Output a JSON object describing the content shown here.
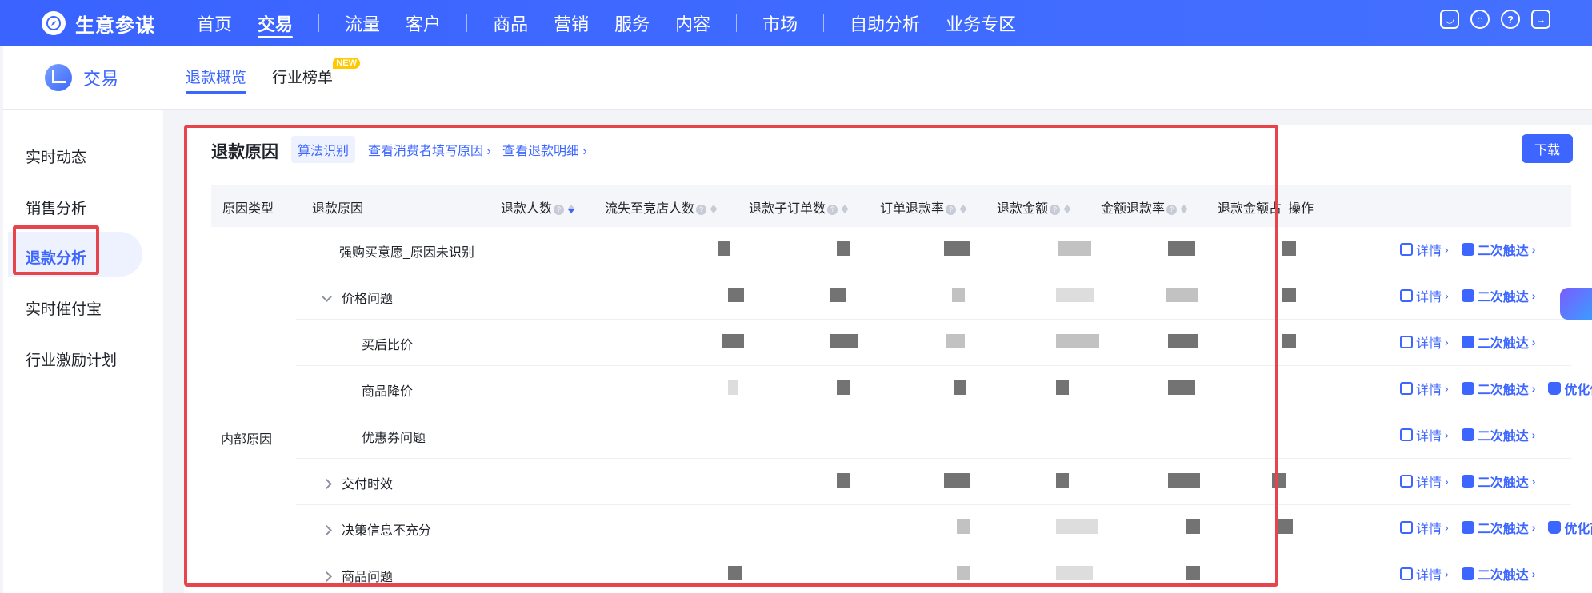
{
  "brand": {
    "name": "生意参谋"
  },
  "nav": {
    "items": [
      "首页",
      "交易",
      "流量",
      "客户",
      "商品",
      "营销",
      "服务",
      "内容",
      "市场",
      "自助分析",
      "业务专区"
    ],
    "active": "交易"
  },
  "module": {
    "name": "交易"
  },
  "subtabs": [
    {
      "label": "退款概览",
      "active": true
    },
    {
      "label": "行业榜单",
      "badge": "NEW"
    }
  ],
  "sidebar": {
    "items": [
      "实时动态",
      "销售分析",
      "退款分析",
      "实时催付宝",
      "行业激励计划"
    ],
    "active": "退款分析"
  },
  "section": {
    "title": "退款原因",
    "algo_tag": "算法识别",
    "link_consumer": "查看消费者填写原因",
    "link_detail": "查看退款明细",
    "download": "下载"
  },
  "table": {
    "headers": {
      "type": "原因类型",
      "reason": "退款原因",
      "refund_people": "退款人数",
      "lost_people": "流失至竞店人数",
      "sub_orders": "退款子订单数",
      "order_rate": "订单退款率",
      "amount": "退款金额",
      "amount_rate": "金额退款率",
      "amount_share": "退款金额占",
      "ops": "操作"
    },
    "category": "内部原因",
    "rows": [
      {
        "reason": "强购买意愿_原因未识别",
        "extra_op": ""
      },
      {
        "reason": "价格问题",
        "extra_op": ""
      },
      {
        "reason": "买后比价",
        "extra_op": ""
      },
      {
        "reason": "商品降价",
        "extra_op": "优化保价策略"
      },
      {
        "reason": "优惠券问题",
        "extra_op": ""
      },
      {
        "reason": "交付时效",
        "extra_op": ""
      },
      {
        "reason": "决策信息不充分",
        "extra_op": "优化商品详情"
      },
      {
        "reason": "商品问题",
        "extra_op": ""
      }
    ],
    "op_detail": "详情",
    "op_reach": "二次触达"
  }
}
